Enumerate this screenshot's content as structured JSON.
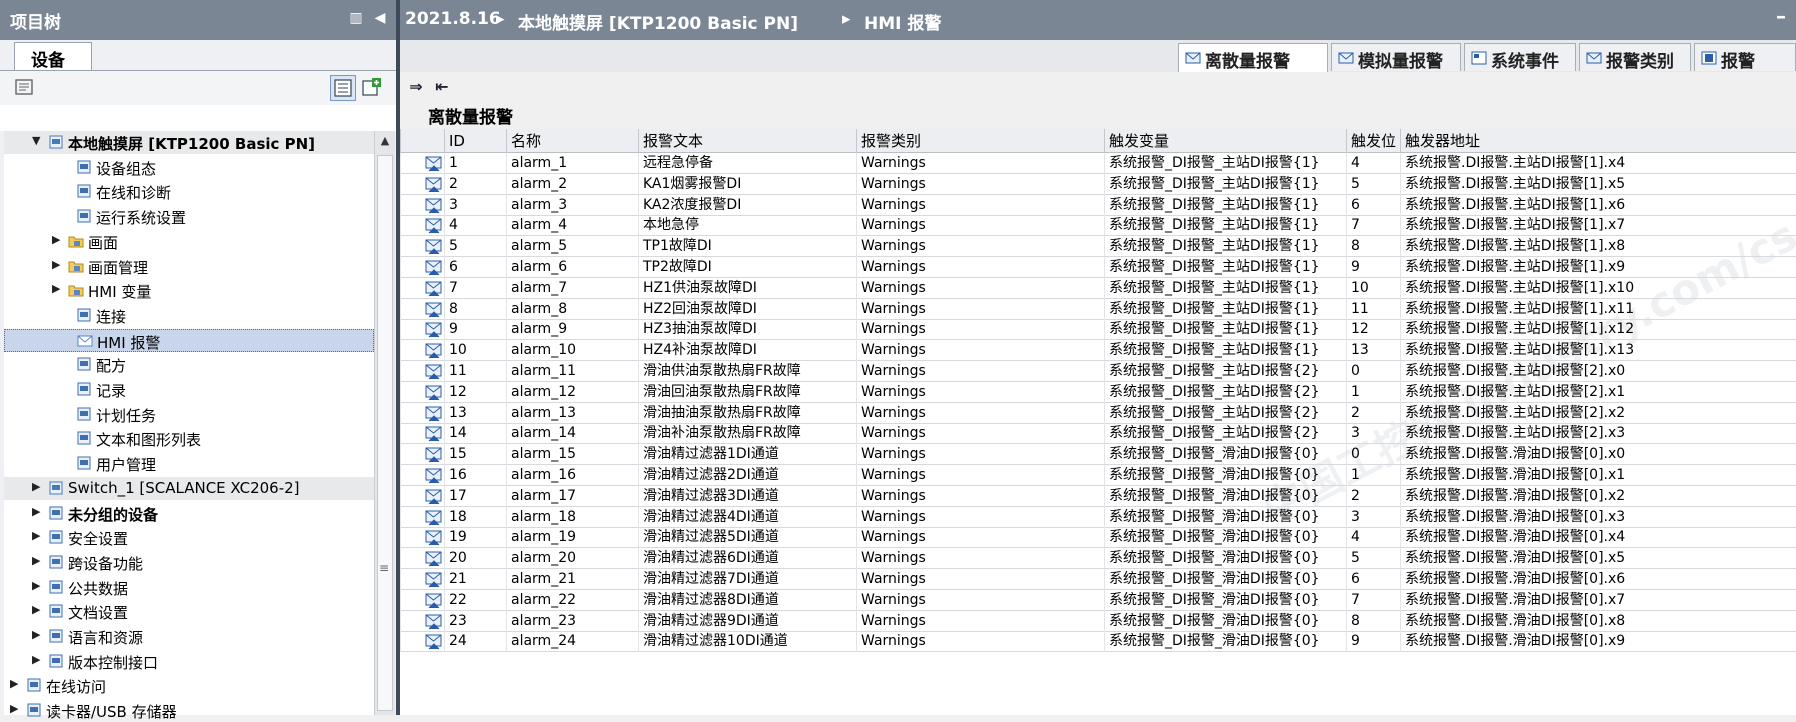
{
  "left_panel": {
    "title": "项目树",
    "tab": "设备",
    "tree": [
      {
        "label": "本地触摸屏 [KTP1200 Basic PN]",
        "arrow": "▼",
        "indent": 0,
        "bold": true,
        "grey": true,
        "icon": "device-icon"
      },
      {
        "label": "设备组态",
        "arrow": "",
        "indent": 2,
        "icon": "config-icon"
      },
      {
        "label": "在线和诊断",
        "arrow": "",
        "indent": 2,
        "icon": "diagnostics-icon"
      },
      {
        "label": "运行系统设置",
        "arrow": "",
        "indent": 2,
        "icon": "runtime-settings-icon"
      },
      {
        "label": "画面",
        "arrow": "▶",
        "indent": 1,
        "icon": "folder-icon"
      },
      {
        "label": "画面管理",
        "arrow": "▶",
        "indent": 1,
        "icon": "folder-icon"
      },
      {
        "label": "HMI 变量",
        "arrow": "▶",
        "indent": 1,
        "icon": "folder-icon"
      },
      {
        "label": "连接",
        "arrow": "",
        "indent": 2,
        "icon": "connection-icon"
      },
      {
        "label": "HMI 报警",
        "arrow": "",
        "indent": 2,
        "icon": "alarm-icon",
        "selected": true
      },
      {
        "label": "配方",
        "arrow": "",
        "indent": 2,
        "icon": "recipe-icon"
      },
      {
        "label": "记录",
        "arrow": "",
        "indent": 2,
        "icon": "log-icon"
      },
      {
        "label": "计划任务",
        "arrow": "",
        "indent": 2,
        "icon": "scheduler-icon"
      },
      {
        "label": "文本和图形列表",
        "arrow": "",
        "indent": 2,
        "icon": "text-list-icon"
      },
      {
        "label": "用户管理",
        "arrow": "",
        "indent": 2,
        "icon": "user-admin-icon"
      },
      {
        "label": "Switch_1 [SCALANCE XC206-2]",
        "arrow": "▶",
        "indent": 0,
        "grey": true,
        "icon": "device-icon"
      },
      {
        "label": "未分组的设备",
        "arrow": "▶",
        "indent": 0,
        "bold": true,
        "icon": "device-group-icon"
      },
      {
        "label": "安全设置",
        "arrow": "▶",
        "indent": 0,
        "icon": "security-icon"
      },
      {
        "label": "跨设备功能",
        "arrow": "▶",
        "indent": 0,
        "icon": "cross-device-icon"
      },
      {
        "label": "公共数据",
        "arrow": "▶",
        "indent": 0,
        "icon": "common-data-icon"
      },
      {
        "label": "文档设置",
        "arrow": "▶",
        "indent": 0,
        "icon": "doc-settings-icon"
      },
      {
        "label": "语言和资源",
        "arrow": "▶",
        "indent": 0,
        "icon": "language-icon"
      },
      {
        "label": "版本控制接口",
        "arrow": "▶",
        "indent": 0,
        "icon": "version-control-icon"
      },
      {
        "label": "在线访问",
        "arrow": "▶",
        "indent": -1,
        "icon": "online-access-icon"
      },
      {
        "label": "读卡器/USB 存储器",
        "arrow": "▶",
        "indent": -1,
        "icon": "card-reader-icon"
      }
    ]
  },
  "editor": {
    "breadcrumb": [
      "2021.8.16",
      "本地触摸屏 [KTP1200 Basic PN]",
      "HMI 报警"
    ],
    "breadcrumb_sep": "▸",
    "tabs": [
      {
        "label": "离散量报警",
        "active": true
      },
      {
        "label": "模拟量报警"
      },
      {
        "label": "系统事件"
      },
      {
        "label": "报警类别"
      },
      {
        "label": "报警"
      }
    ],
    "section_title": "离散量报警",
    "columns": [
      "ID",
      "名称",
      "报警文本",
      "报警类别",
      "触发变量",
      "触发位",
      "触发器地址"
    ],
    "rows": [
      [
        "1",
        "alarm_1",
        "远程急停备",
        "Warnings",
        "系统报警_DI报警_主站DI报警{1}",
        "4",
        "系统报警.DI报警.主站DI报警[1].x4"
      ],
      [
        "2",
        "alarm_2",
        "KA1烟雾报警DI",
        "Warnings",
        "系统报警_DI报警_主站DI报警{1}",
        "5",
        "系统报警.DI报警.主站DI报警[1].x5"
      ],
      [
        "3",
        "alarm_3",
        "KA2浓度报警DI",
        "Warnings",
        "系统报警_DI报警_主站DI报警{1}",
        "6",
        "系统报警.DI报警.主站DI报警[1].x6"
      ],
      [
        "4",
        "alarm_4",
        "本地急停",
        "Warnings",
        "系统报警_DI报警_主站DI报警{1}",
        "7",
        "系统报警.DI报警.主站DI报警[1].x7"
      ],
      [
        "5",
        "alarm_5",
        "TP1故障DI",
        "Warnings",
        "系统报警_DI报警_主站DI报警{1}",
        "8",
        "系统报警.DI报警.主站DI报警[1].x8"
      ],
      [
        "6",
        "alarm_6",
        "TP2故障DI",
        "Warnings",
        "系统报警_DI报警_主站DI报警{1}",
        "9",
        "系统报警.DI报警.主站DI报警[1].x9"
      ],
      [
        "7",
        "alarm_7",
        "HZ1供油泵故障DI",
        "Warnings",
        "系统报警_DI报警_主站DI报警{1}",
        "10",
        "系统报警.DI报警.主站DI报警[1].x10"
      ],
      [
        "8",
        "alarm_8",
        "HZ2回油泵故障DI",
        "Warnings",
        "系统报警_DI报警_主站DI报警{1}",
        "11",
        "系统报警.DI报警.主站DI报警[1].x11"
      ],
      [
        "9",
        "alarm_9",
        "HZ3抽油泵故障DI",
        "Warnings",
        "系统报警_DI报警_主站DI报警{1}",
        "12",
        "系统报警.DI报警.主站DI报警[1].x12"
      ],
      [
        "10",
        "alarm_10",
        "HZ4补油泵故障DI",
        "Warnings",
        "系统报警_DI报警_主站DI报警{1}",
        "13",
        "系统报警.DI报警.主站DI报警[1].x13"
      ],
      [
        "11",
        "alarm_11",
        "滑油供油泵散热扇FR故障",
        "Warnings",
        "系统报警_DI报警_主站DI报警{2}",
        "0",
        "系统报警.DI报警.主站DI报警[2].x0"
      ],
      [
        "12",
        "alarm_12",
        "滑油回油泵散热扇FR故障",
        "Warnings",
        "系统报警_DI报警_主站DI报警{2}",
        "1",
        "系统报警.DI报警.主站DI报警[2].x1"
      ],
      [
        "13",
        "alarm_13",
        "滑油抽油泵散热扇FR故障",
        "Warnings",
        "系统报警_DI报警_主站DI报警{2}",
        "2",
        "系统报警.DI报警.主站DI报警[2].x2"
      ],
      [
        "14",
        "alarm_14",
        "滑油补油泵散热扇FR故障",
        "Warnings",
        "系统报警_DI报警_主站DI报警{2}",
        "3",
        "系统报警.DI报警.主站DI报警[2].x3"
      ],
      [
        "15",
        "alarm_15",
        "滑油精过滤器1DI通道",
        "Warnings",
        "系统报警_DI报警_滑油DI报警{0}",
        "0",
        "系统报警.DI报警.滑油DI报警[0].x0"
      ],
      [
        "16",
        "alarm_16",
        "滑油精过滤器2DI通道",
        "Warnings",
        "系统报警_DI报警_滑油DI报警{0}",
        "1",
        "系统报警.DI报警.滑油DI报警[0].x1"
      ],
      [
        "17",
        "alarm_17",
        "滑油精过滤器3DI通道",
        "Warnings",
        "系统报警_DI报警_滑油DI报警{0}",
        "2",
        "系统报警.DI报警.滑油DI报警[0].x2"
      ],
      [
        "18",
        "alarm_18",
        "滑油精过滤器4DI通道",
        "Warnings",
        "系统报警_DI报警_滑油DI报警{0}",
        "3",
        "系统报警.DI报警.滑油DI报警[0].x3"
      ],
      [
        "19",
        "alarm_19",
        "滑油精过滤器5DI通道",
        "Warnings",
        "系统报警_DI报警_滑油DI报警{0}",
        "4",
        "系统报警.DI报警.滑油DI报警[0].x4"
      ],
      [
        "20",
        "alarm_20",
        "滑油精过滤器6DI通道",
        "Warnings",
        "系统报警_DI报警_滑油DI报警{0}",
        "5",
        "系统报警.DI报警.滑油DI报警[0].x5"
      ],
      [
        "21",
        "alarm_21",
        "滑油精过滤器7DI通道",
        "Warnings",
        "系统报警_DI报警_滑油DI报警{0}",
        "6",
        "系统报警.DI报警.滑油DI报警[0].x6"
      ],
      [
        "22",
        "alarm_22",
        "滑油精过滤器8DI通道",
        "Warnings",
        "系统报警_DI报警_滑油DI报警{0}",
        "7",
        "系统报警.DI报警.滑油DI报警[0].x7"
      ],
      [
        "23",
        "alarm_23",
        "滑油精过滤器9DI通道",
        "Warnings",
        "系统报警_DI报警_滑油DI报警{0}",
        "8",
        "系统报警.DI报警.滑油DI报警[0].x8"
      ],
      [
        "24",
        "alarm_24",
        "滑油精过滤器10DI通道",
        "Warnings",
        "系统报警_DI报警_滑油DI报警{0}",
        "9",
        "系统报警.DI报警.滑油DI报警[0].x9"
      ]
    ]
  }
}
